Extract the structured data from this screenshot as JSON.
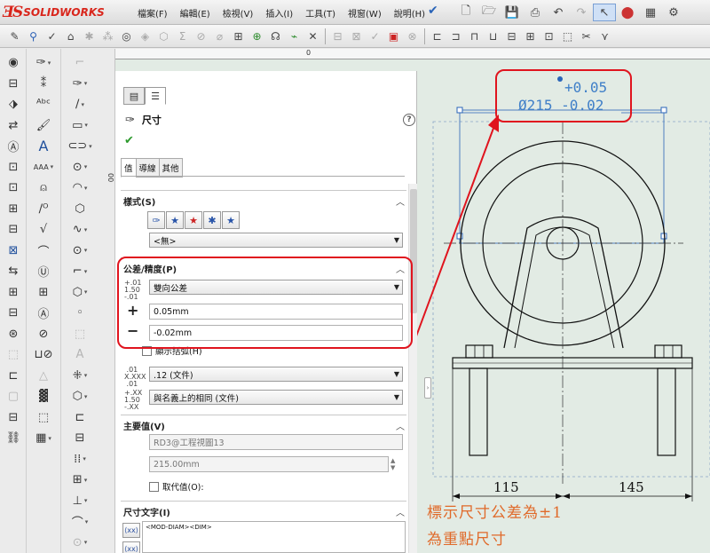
{
  "app": {
    "brand": "SOLIDWORKS"
  },
  "menu": [
    "檔案(F)",
    "編輯(E)",
    "檢視(V)",
    "插入(I)",
    "工具(T)",
    "視窗(W)",
    "說明(H)"
  ],
  "property_manager": {
    "title": "尺寸",
    "tabs": [
      "值",
      "導線",
      "其他"
    ],
    "style_group": {
      "title": "樣式(S)",
      "style_value": "<無>"
    },
    "tolerance_group": {
      "title": "公差/精度(P)",
      "tolerance_type": "雙向公差",
      "plus_value": "0.05mm",
      "minus_value": "-0.02mm",
      "show_parentheses_label": "顯示括弧(H)",
      "precision": ".12 (文件)",
      "tolerance_precision": "與名義上的相同 (文件)"
    },
    "primary_value_group": {
      "title": "主要值(V)",
      "reference": "RD3@工程視圖13",
      "value": "215.00mm",
      "override_label": "取代值(O):"
    },
    "dimension_text_group": {
      "title": "尺寸文字(I)",
      "text": "<MOD-DIAM><DIM>"
    }
  },
  "graphics": {
    "ruler_zero": "0",
    "vruler_label": "00",
    "tolerance_upper": "+0.05",
    "tolerance_main": "Ø215 -0.02",
    "dim_left": "115",
    "dim_right": "145",
    "note_line1": "標示尺寸公差為±1",
    "note_line2": "為重點尺寸"
  },
  "colors": {
    "highlight": "#e0141e",
    "dimension_blue": "#3f7fc8",
    "note_orange": "#e06a2a"
  }
}
